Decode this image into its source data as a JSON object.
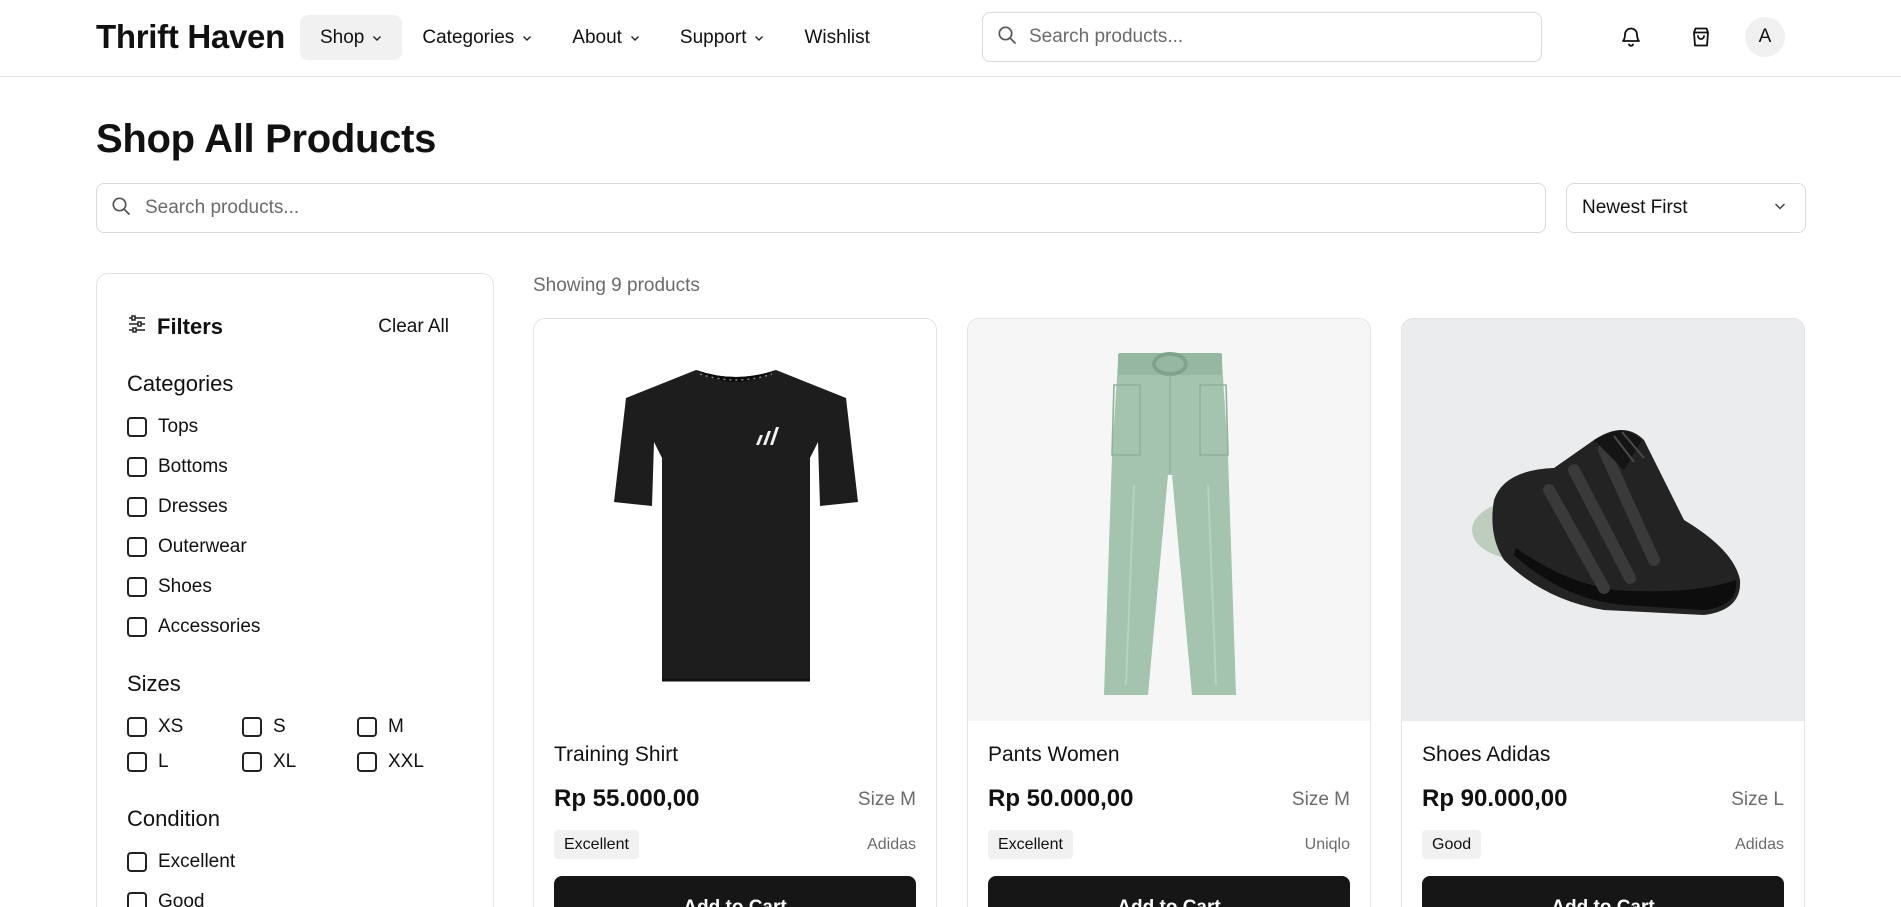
{
  "brand": "Thrift Haven",
  "nav": [
    {
      "label": "Shop"
    },
    {
      "label": "Categories"
    },
    {
      "label": "About"
    },
    {
      "label": "Support"
    },
    {
      "label": "Wishlist"
    }
  ],
  "header": {
    "search_placeholder": "Search products...",
    "bell_icon": "bell-icon",
    "cart_icon": "shopping-bag-icon",
    "avatar_initial": "A"
  },
  "page": {
    "title": "Shop All Products",
    "search_placeholder": "Search products...",
    "sort_value": "Newest First",
    "showing_text": "Showing 9 products"
  },
  "filters": {
    "title": "Filters",
    "clear_label": "Clear All",
    "categories_title": "Categories",
    "categories": [
      "Tops",
      "Bottoms",
      "Dresses",
      "Outerwear",
      "Shoes",
      "Accessories"
    ],
    "sizes_title": "Sizes",
    "sizes": [
      "XS",
      "S",
      "M",
      "L",
      "XL",
      "XXL"
    ],
    "condition_title": "Condition",
    "conditions": [
      "Excellent",
      "Good"
    ]
  },
  "products": [
    {
      "name": "Training Shirt",
      "price": "Rp 55.000,00",
      "size": "Size M",
      "condition": "Excellent",
      "brand": "Adidas",
      "button": "Add to Cart",
      "image": "black-tshirt"
    },
    {
      "name": "Pants Women",
      "price": "Rp 50.000,00",
      "size": "Size M",
      "condition": "Excellent",
      "brand": "Uniqlo",
      "button": "Add to Cart",
      "image": "green-pants"
    },
    {
      "name": "Shoes Adidas",
      "price": "Rp 90.000,00",
      "size": "Size L",
      "condition": "Good",
      "brand": "Adidas",
      "button": "Add to Cart",
      "image": "black-sneaker"
    }
  ],
  "colors": {
    "button_bg": "#161616",
    "muted_text": "#6b6b6b",
    "border": "#e3e3e3",
    "active_nav_bg": "#f1f1f1"
  }
}
